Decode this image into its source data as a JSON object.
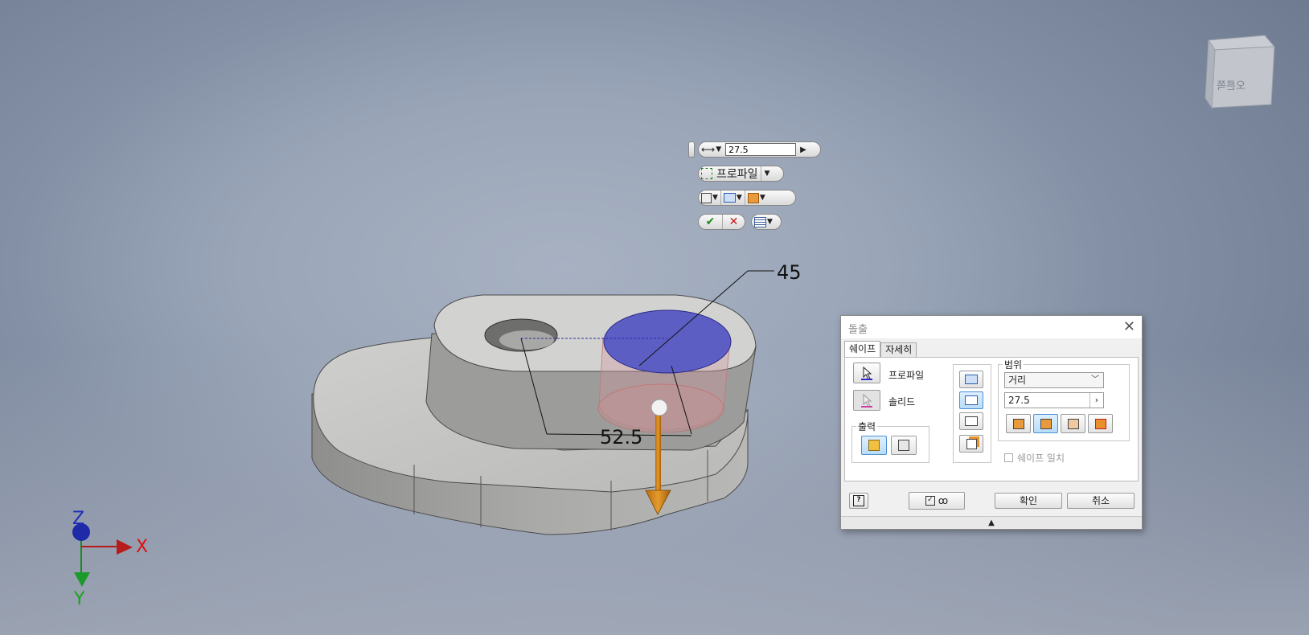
{
  "mini_toolbar": {
    "distance_value": "27.5",
    "profile_label": "프로파일",
    "icons": [
      "distance-icon",
      "profile-select-icon",
      "output-shape-icon",
      "direction-icon",
      "taper-icon",
      "ok-check-icon",
      "cancel-x-icon",
      "options-icon"
    ]
  },
  "viewport": {
    "dim_primary": "45",
    "dim_secondary": "52.5",
    "axis_x": "X",
    "axis_y": "Y",
    "axis_z": "Z",
    "viewcube_text": "오른쪽"
  },
  "dialog": {
    "title": "돌출",
    "tabs": [
      "쉐이프",
      "자세히"
    ],
    "profile_label": "프로파일",
    "solid_label": "솔리드",
    "output_label": "출력",
    "extents_label": "범위",
    "extents_type": "거리",
    "distance": "27.5",
    "match_shape_label": "쉐이프 일치",
    "ok_label": "확인",
    "cancel_label": "취소",
    "expand_glyph": "▲",
    "colors": {
      "selected": "#b8dcf8",
      "accent": "#4d8fd0"
    }
  }
}
